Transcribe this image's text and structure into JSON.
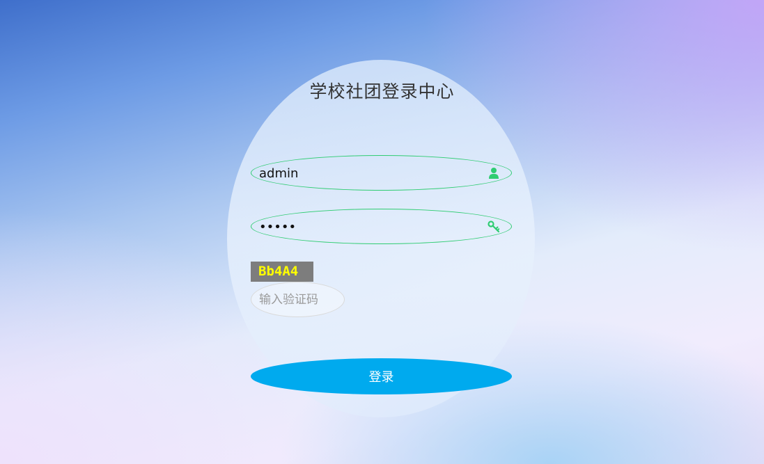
{
  "page": {
    "title": "学校社团登录中心"
  },
  "form": {
    "username": {
      "value": "admin",
      "icon": "user-icon"
    },
    "password": {
      "value": "admin",
      "icon": "key-icon"
    },
    "captcha": {
      "code": "Bb4A4",
      "placeholder": "输入验证码",
      "value": ""
    },
    "submit_label": "登录"
  },
  "colors": {
    "accent_green": "#2ecc71",
    "button_blue": "#00aaee",
    "captcha_bg": "#7d7d7d",
    "captcha_text": "#ffff00",
    "title_text": "#333333"
  }
}
